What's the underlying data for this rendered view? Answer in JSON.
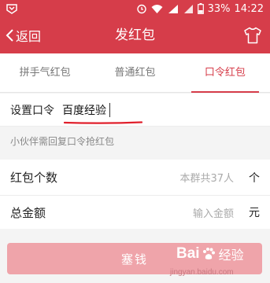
{
  "status_bar": {
    "battery": "33%",
    "time": "14:22",
    "network_badge": "4G"
  },
  "nav": {
    "back_label": "返回",
    "title": "发红包"
  },
  "tabs": [
    {
      "label": "拼手气红包",
      "active": false
    },
    {
      "label": "普通红包",
      "active": false
    },
    {
      "label": "口令红包",
      "active": true
    }
  ],
  "password": {
    "label": "设置口令",
    "value": "百度经验"
  },
  "hint": "小伙伴需回复口令抢红包",
  "count": {
    "label": "红包个数",
    "placeholder": "本群共37人",
    "unit": "个"
  },
  "amount": {
    "label": "总金额",
    "placeholder": "输入金额",
    "unit": "元"
  },
  "submit_label": "塞钱",
  "watermark": {
    "brand_left": "Bai",
    "brand_right": "经验",
    "url": "jingyan.baidu.com"
  },
  "colors": {
    "brand_red": "#d63d4a",
    "button_disabled": "#efa4aa"
  }
}
